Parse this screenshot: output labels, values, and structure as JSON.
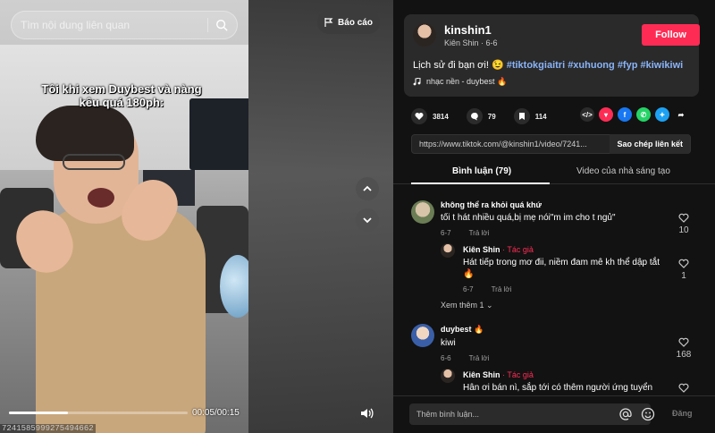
{
  "search": {
    "placeholder": "Tìm nội dung liên quan"
  },
  "report": {
    "label": "Báo cáo"
  },
  "video": {
    "caption": "Tôi khi xem Duybest và nàng kêu quá 180ph:",
    "time": "00:05/00:15",
    "progress": 0.33,
    "id_fragment": "7241585999275494662"
  },
  "author": {
    "username": "kinshin1",
    "display_name": "Kiên Shin",
    "date": "6-6",
    "follow_label": "Follow"
  },
  "description": {
    "text": "Lịch sử đi bạn ơi! 😉",
    "hashtags": [
      "#tiktokgiaitri",
      "#xuhuong",
      "#fyp",
      "#kiwikiwi"
    ]
  },
  "music": {
    "label": "nhạc nền - duybest 🔥"
  },
  "actions": {
    "likes": "3814",
    "comments": "79",
    "saves": "114"
  },
  "share": {
    "url": "https://www.tiktok.com/@kinshin1/video/7241...",
    "copy_label": "Sao chép liên kết"
  },
  "tabs": {
    "comments": "Bình luận (79)",
    "creator_videos": "Video của nhà sáng tạo"
  },
  "comments": [
    {
      "name": "không thể ra khỏi quá khứ",
      "text": "tối t hát nhiều quá,bị mẹ nói\"m im cho t ngủ\"",
      "date": "6-7",
      "reply": "Trả lời",
      "likes": "10"
    },
    {
      "name": "Kiên Shin",
      "badge": "· Tác giả",
      "text": "Hát tiếp trong mơ đii, niềm đam mê kh thể dập tắt 🔥",
      "date": "6-7",
      "reply": "Trả lời",
      "likes": "1"
    },
    {
      "name": "duybest 🔥",
      "text": "kiwi",
      "date": "6-6",
      "reply": "Trả lời",
      "likes": "168"
    },
    {
      "name": "Kiên Shin",
      "badge": "· Tác giả",
      "text": "Hân ơi bán nì, sắp tới có thêm người ứng tuyển"
    }
  ],
  "more": {
    "label": "Xem thêm 1"
  },
  "composer": {
    "placeholder": "Thêm bình luận...",
    "post_label": "Đăng"
  },
  "colors": {
    "accent": "#fe2c55",
    "hashtag": "#8ab4f8",
    "panel": "#121212",
    "card": "#2a2a2a"
  }
}
